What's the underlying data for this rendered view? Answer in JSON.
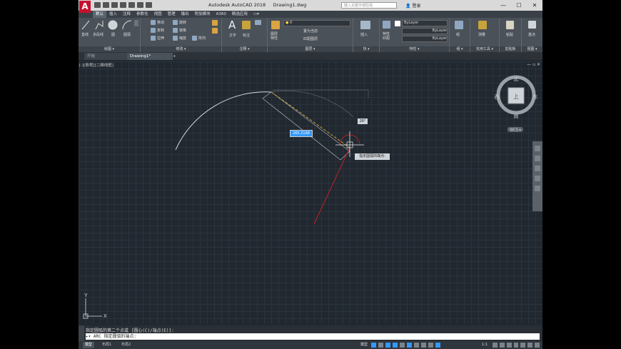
{
  "app": {
    "logo": "A",
    "title": "Autodesk AutoCAD 2018",
    "filename": "Drawing1.dwg",
    "search_placeholder": "键入关键字或短语",
    "signin_label": "登录",
    "window_controls": [
      "—",
      "☐",
      "✕"
    ]
  },
  "ribbon_tabs": [
    "默认",
    "插入",
    "注释",
    "参数化",
    "视图",
    "管理",
    "输出",
    "附加模块",
    "A360",
    "精选应用",
    "▭▾"
  ],
  "ribbon": {
    "draw": {
      "panel_label": "绘图 ▾",
      "line": "直线",
      "polyline": "多段线",
      "circle": "圆",
      "arc": "圆弧"
    },
    "modify": {
      "panel_label": "修改 ▾",
      "move": "移动",
      "rotate": "旋转",
      "copy": "复制",
      "mirror": "镜像",
      "stretch": "拉伸",
      "scale": "缩放",
      "array": "阵列"
    },
    "annotation": {
      "panel_label": "注释 ▾",
      "text": "文字",
      "dimension": "标注"
    },
    "layers": {
      "panel_label": "图层 ▾",
      "layer_props": "图层\n特性",
      "current_layer": "0",
      "set_current": "置为当前",
      "match_layer": "匹配图层"
    },
    "block": {
      "panel_label": "块 ▾",
      "insert": "插入"
    },
    "properties": {
      "panel_label": "特性 ▾",
      "props": "特性\n匹配",
      "bylayer1": "ByLayer",
      "bylayer2": "ByLayer",
      "bylayer3": "ByLayer"
    },
    "groups": {
      "panel_label": "组 ▾",
      "group": "组"
    },
    "utilities": {
      "panel_label": "实用工具 ▾",
      "measure": "测量"
    },
    "clipboard": {
      "panel_label": "剪贴板",
      "paste": "粘贴"
    },
    "view": {
      "panel_label": "视图 ▾",
      "base": "基点"
    }
  },
  "doc_tabs": {
    "start": "开始",
    "drawing": "Drawing1*",
    "add": "+"
  },
  "viewport": {
    "label": "[-][俯视][二维线框]",
    "controls": "—  ▫  ✕",
    "viewcube": {
      "north": "北",
      "south": "南",
      "east": "东",
      "west": "西",
      "top": "上",
      "wcs": "WCS ▾"
    },
    "dynamic_input_value": "265.2198",
    "angle_tooltip": "26°",
    "prompt_tooltip": "指定圆弧的端点:",
    "ucs_x": "X",
    "ucs_y": "Y"
  },
  "command": {
    "history": "指定圆弧的第二个点或 [圆心(C)/端点(E)]:",
    "prompt_prefix": "ARC",
    "current": "指定圆弧的端点:"
  },
  "status": {
    "model": "模型",
    "layout1": "布局1",
    "layout2": "布局2",
    "model_label": "模型",
    "scale": "1:1"
  },
  "colors": {
    "accent": "#c8102e",
    "highlight": "#3399ff",
    "rubberband": "#cc2222",
    "dimension": "#c8a23a"
  }
}
